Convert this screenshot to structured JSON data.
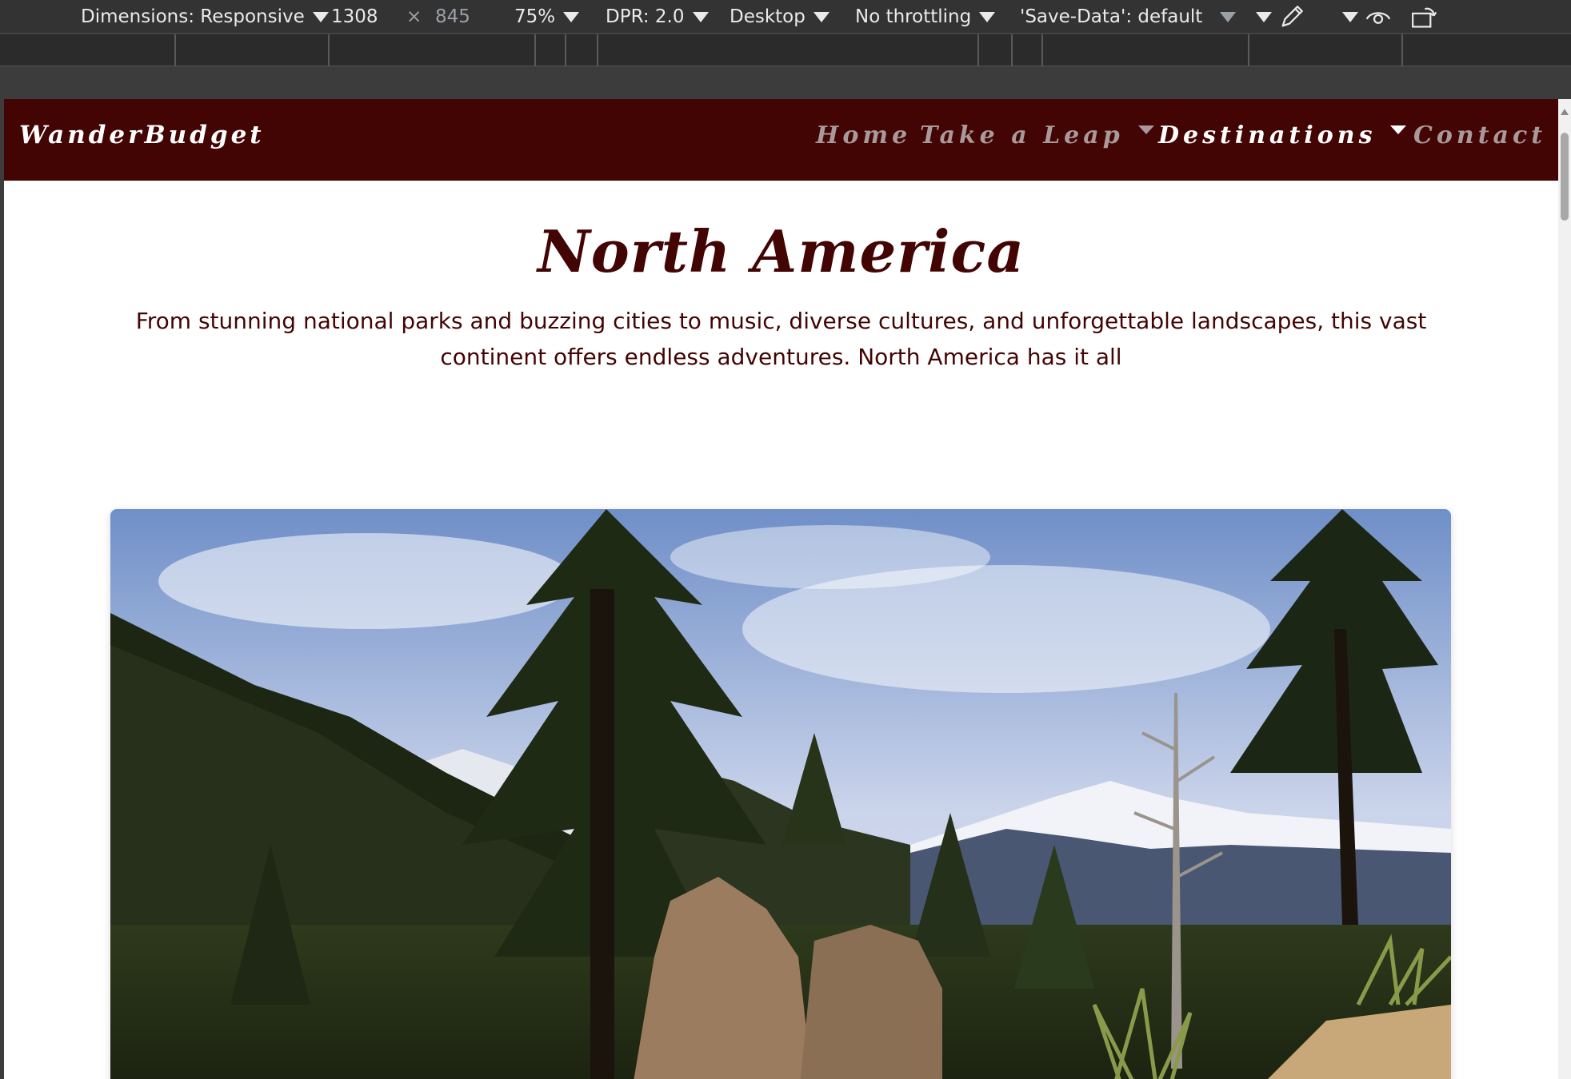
{
  "devtools": {
    "dimensions_label": "Dimensions: Responsive",
    "width": "1308",
    "times": "×",
    "height": "845",
    "zoom": "75%",
    "dpr": "DPR: 2.0",
    "device": "Desktop",
    "throttling": "No throttling",
    "save_data": "'Save-Data': default"
  },
  "site": {
    "brand": "WanderBudget",
    "nav": [
      {
        "label": "Home"
      },
      {
        "label": "Take a Leap"
      },
      {
        "label": "Destinations"
      },
      {
        "label": "Contact"
      }
    ]
  },
  "page": {
    "title": "North America",
    "description": "From stunning national parks and buzzing cities to music, diverse cultures, and unforgettable landscapes, this vast continent offers endless adventures. North America has it all"
  },
  "colors": {
    "brand_dark": "#430404",
    "nav_inactive": "#a89a9a",
    "nav_active": "#ffffff"
  },
  "icons": [
    "chevron-down-icon",
    "eyedropper-icon",
    "eye-icon",
    "rotate-icon",
    "scroll-up-arrow-icon"
  ]
}
